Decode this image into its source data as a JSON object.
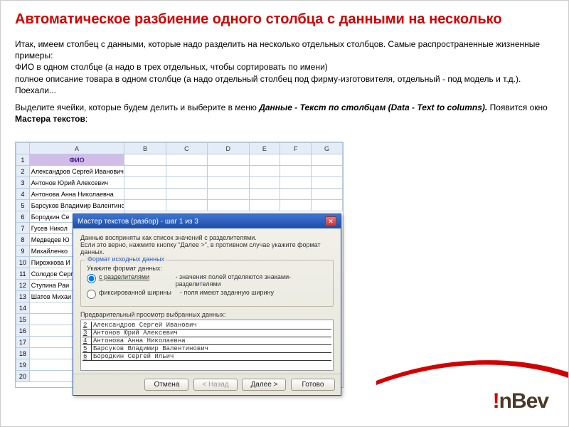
{
  "title": "Автоматическое разбиение одного столбца с данными на несколько",
  "para1": "Итак, имеем столбец с данными, которые надо разделить на несколько отдельных столбцов. Самые распространенные жизненные примеры:\nФИО в одном столбце (а надо в трех отдельных, чтобы сортировать по имени)\nполное описание товара в одном столбце (а надо отдельный столбец под фирму-изготовителя, отдельный - под модель и т.д.).\nПоехали...",
  "para2a": "Выделите ячейки, которые будем делить и выберите в меню ",
  "para2b": "Данные - Текст по столбцам (Data - Text to columns). ",
  "para2c": "Появится окно ",
  "para2d": "Мастера текстов",
  "para2e": ":",
  "spreadsheet": {
    "col_headers": [
      "A",
      "B",
      "C",
      "D",
      "E",
      "F",
      "G"
    ],
    "fio_header": "ФИО",
    "rows": [
      "Александров Сергей Иванович",
      "Антонов Юрий Алексевич",
      "Антонова Анна Николаевна",
      "Барсуков Владимир Валентинович",
      "Бородкин Се",
      "Гусев Никол",
      "Медведев Ю",
      "Михайленко",
      "Пирожкова И",
      "Солодов Серг",
      "Ступина Раи",
      "Шатов Михаи"
    ]
  },
  "dialog": {
    "title": "Мастер текстов (разбор) - шаг 1 из 3",
    "intro1": "Данные восприняты как список значений с разделителями.",
    "intro2": "Если это верно, нажмите кнопку \"Далее >\", в противном случае укажите формат данных.",
    "group1_legend": "Формат исходных данных",
    "group1_prompt": "Укажите формат данных:",
    "opt1_label": "с разделителями",
    "opt1_hint": "- значения полей отделяются знаками-разделителями",
    "opt2_label": "фиксированной ширины",
    "opt2_hint": "- поля имеют заданную ширину",
    "preview_label": "Предварительный просмотр выбранных данных:",
    "preview_rows": [
      "Александров Сергей Иванович",
      "Антонов Юрий Алексевич",
      "Антонова Анна Николаевна",
      "Барсуков Владимир Валентинович",
      "Бородкин Сергей Ильич"
    ],
    "btn_cancel": "Отмена",
    "btn_back": "< Назад",
    "btn_next": "Далее >",
    "btn_finish": "Готово"
  },
  "logo": {
    "part1": "I",
    "part2": "n",
    "part3": "Bev",
    "dot": "!"
  }
}
